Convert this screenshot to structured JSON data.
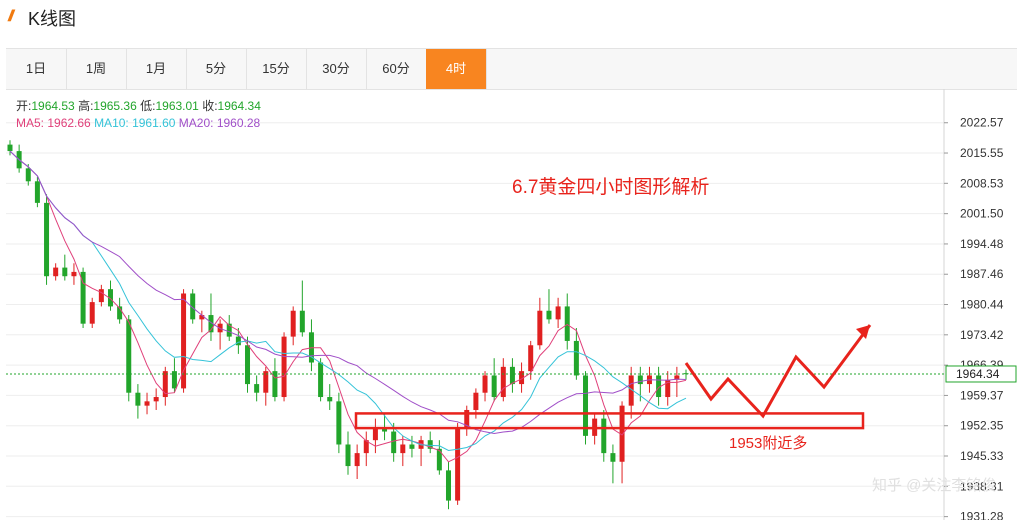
{
  "app": {
    "logo_text": "//",
    "title": "K线图"
  },
  "tabs": [
    {
      "label": "1日",
      "active": false
    },
    {
      "label": "1周",
      "active": false
    },
    {
      "label": "1月",
      "active": false
    },
    {
      "label": "5分",
      "active": false
    },
    {
      "label": "15分",
      "active": false
    },
    {
      "label": "30分",
      "active": false
    },
    {
      "label": "60分",
      "active": false
    },
    {
      "label": "4时",
      "active": true
    }
  ],
  "ohlc_info": {
    "open_label": "开:",
    "open": "1964.53",
    "high_label": "高:",
    "high": "1965.36",
    "low_label": "低:",
    "low": "1963.01",
    "close_label": "收:",
    "close": "1964.34"
  },
  "ma_info": {
    "ma5_label": "MA5:",
    "ma5": "1962.66",
    "ma10_label": "MA10:",
    "ma10": "1961.60",
    "ma20_label": "MA20:",
    "ma20": "1960.28"
  },
  "colors": {
    "up": "#e02020",
    "down": "#22a52b",
    "ma5": "#e0407a",
    "ma10": "#35c3d8",
    "ma20": "#a04fc8",
    "annotation": "#e8231c",
    "tab_active": "#f88520",
    "price_line": "#22a52b"
  },
  "annotation": {
    "headline": "6.7黄金四小时图形解析",
    "zone_label": "1953附近多"
  },
  "watermark": "知乎 @关注李铭俊",
  "chart_data": {
    "type": "candlestick",
    "y_ticks": [
      "2022.57",
      "2015.55",
      "2008.53",
      "2001.50",
      "1994.48",
      "1987.46",
      "1980.44",
      "1973.42",
      "1966.39",
      "1959.37",
      "1952.35",
      "1945.33",
      "1938.31",
      "1931.28"
    ],
    "y_tick_values": [
      2022.57,
      2015.55,
      2008.53,
      2001.5,
      1994.48,
      1987.46,
      1980.44,
      1973.42,
      1966.39,
      1959.37,
      1952.35,
      1945.33,
      1938.31,
      1931.28
    ],
    "ylim": [
      1930.5,
      2029
    ],
    "current_price": 1964.34,
    "current_price_label": "1964.34",
    "support_zone": [
      1951.8,
      1955.2
    ],
    "candles": [
      [
        2017.5,
        2018.5,
        2015,
        2016
      ],
      [
        2016,
        2017.5,
        2011,
        2012
      ],
      [
        2012,
        2013,
        2008,
        2009
      ],
      [
        2009,
        2010,
        2003,
        2004
      ],
      [
        2004,
        2006,
        1985,
        1987
      ],
      [
        1987,
        1990,
        1986,
        1989
      ],
      [
        1989,
        1992,
        1986,
        1987
      ],
      [
        1987,
        1990,
        1985,
        1988
      ],
      [
        1988,
        1989,
        1975,
        1976
      ],
      [
        1976,
        1982,
        1975,
        1981
      ],
      [
        1981,
        1985,
        1980,
        1984
      ],
      [
        1984,
        1986,
        1979,
        1980
      ],
      [
        1980,
        1982,
        1976,
        1977
      ],
      [
        1977,
        1978,
        1958,
        1960
      ],
      [
        1960,
        1962,
        1954,
        1957
      ],
      [
        1957,
        1960,
        1955,
        1958
      ],
      [
        1958,
        1961,
        1956,
        1959
      ],
      [
        1959,
        1966,
        1957,
        1965
      ],
      [
        1965,
        1968,
        1960,
        1961
      ],
      [
        1961,
        1984,
        1960,
        1983
      ],
      [
        1983,
        1984,
        1976,
        1977
      ],
      [
        1977,
        1979,
        1974,
        1978
      ],
      [
        1978,
        1983,
        1972,
        1974
      ],
      [
        1974,
        1977,
        1970,
        1976
      ],
      [
        1976,
        1978,
        1972,
        1973
      ],
      [
        1973,
        1975,
        1969,
        1971
      ],
      [
        1971,
        1973,
        1960,
        1962
      ],
      [
        1962,
        1964,
        1958,
        1960
      ],
      [
        1960,
        1966,
        1957,
        1965
      ],
      [
        1965,
        1968,
        1958,
        1959
      ],
      [
        1959,
        1974,
        1958,
        1973
      ],
      [
        1973,
        1980,
        1971,
        1979
      ],
      [
        1979,
        1986,
        1973,
        1974
      ],
      [
        1974,
        1977,
        1965,
        1967
      ],
      [
        1967,
        1968,
        1958,
        1959
      ],
      [
        1959,
        1962,
        1956,
        1958
      ],
      [
        1958,
        1960,
        1946,
        1948
      ],
      [
        1948,
        1951,
        1941,
        1943
      ],
      [
        1943,
        1948,
        1940,
        1946
      ],
      [
        1946,
        1951,
        1943,
        1949
      ],
      [
        1949,
        1954,
        1946,
        1952
      ],
      [
        1952,
        1955,
        1949,
        1951
      ],
      [
        1951,
        1953,
        1944,
        1946
      ],
      [
        1946,
        1950,
        1943,
        1948
      ],
      [
        1948,
        1950,
        1945,
        1947
      ],
      [
        1947,
        1950,
        1943,
        1949
      ],
      [
        1949,
        1951,
        1946,
        1947
      ],
      [
        1947,
        1949,
        1941,
        1942
      ],
      [
        1942,
        1944,
        1933,
        1935
      ],
      [
        1935,
        1953,
        1934,
        1952
      ],
      [
        1952,
        1957,
        1950,
        1956
      ],
      [
        1956,
        1961,
        1954,
        1960
      ],
      [
        1960,
        1965,
        1958,
        1964
      ],
      [
        1964,
        1968,
        1958,
        1959
      ],
      [
        1959,
        1968,
        1958,
        1966
      ],
      [
        1966,
        1968,
        1960,
        1962
      ],
      [
        1962,
        1967,
        1960,
        1965
      ],
      [
        1965,
        1972,
        1963,
        1971
      ],
      [
        1971,
        1982,
        1970,
        1979
      ],
      [
        1979,
        1984,
        1976,
        1977
      ],
      [
        1977,
        1982,
        1975,
        1980
      ],
      [
        1980,
        1983,
        1970,
        1972
      ],
      [
        1972,
        1975,
        1963,
        1964
      ],
      [
        1964,
        1965,
        1948,
        1950
      ],
      [
        1950,
        1955,
        1948,
        1954
      ],
      [
        1954,
        1956,
        1944,
        1946
      ],
      [
        1946,
        1948,
        1939,
        1944
      ],
      [
        1944,
        1958,
        1939,
        1957
      ],
      [
        1957,
        1966,
        1954,
        1964
      ],
      [
        1964,
        1966,
        1958,
        1962
      ],
      [
        1962,
        1966,
        1960,
        1964
      ],
      [
        1964,
        1966,
        1957,
        1959
      ],
      [
        1959,
        1965,
        1957,
        1963
      ],
      [
        1963,
        1966,
        1959,
        1964
      ],
      [
        1964.53,
        1965.36,
        1963.01,
        1964.34
      ]
    ]
  }
}
